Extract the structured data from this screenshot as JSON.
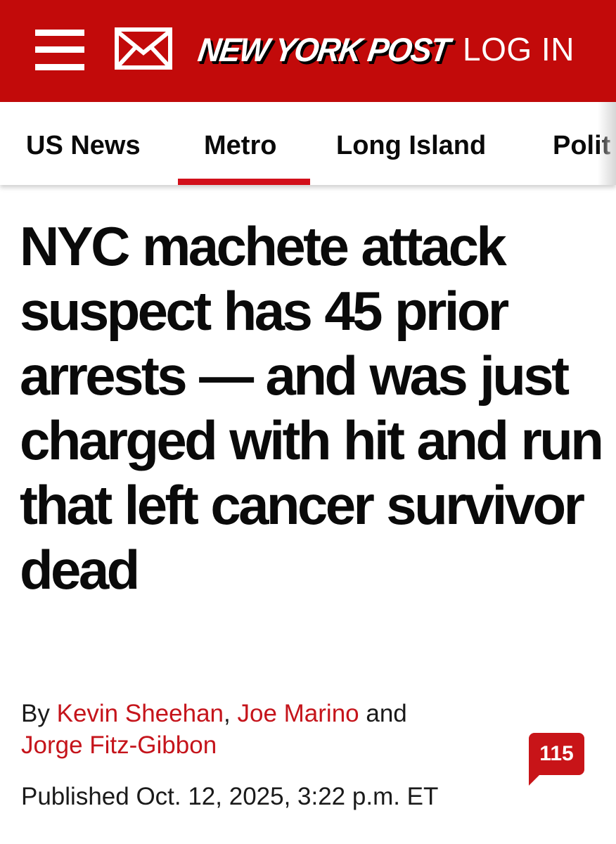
{
  "header": {
    "logo_text": "NEW YORK POST",
    "login_label": "LOG IN",
    "brand_color": "#c20a0a",
    "icons": [
      "menu-icon",
      "mail-icon"
    ]
  },
  "nav": {
    "items": [
      {
        "label": "US News"
      },
      {
        "label": "Metro",
        "active": true
      },
      {
        "label": "Long Island"
      },
      {
        "label": "Polit"
      }
    ],
    "active_color": "#d2101b"
  },
  "article": {
    "headline": "NYC machete attack suspect has 45 prior arrests — and was just charged with hit and run that left cancer survivor dead",
    "byline_prefix": "By",
    "authors": [
      "Kevin Sheehan",
      "Joe Marino",
      "Jorge Fitz-Gibbon"
    ],
    "byline_sep": ",",
    "byline_and": "and",
    "author_color": "#c5141b",
    "published": "Published Oct. 12, 2025, 3:22 p.m. ET",
    "comment_count": "115"
  }
}
